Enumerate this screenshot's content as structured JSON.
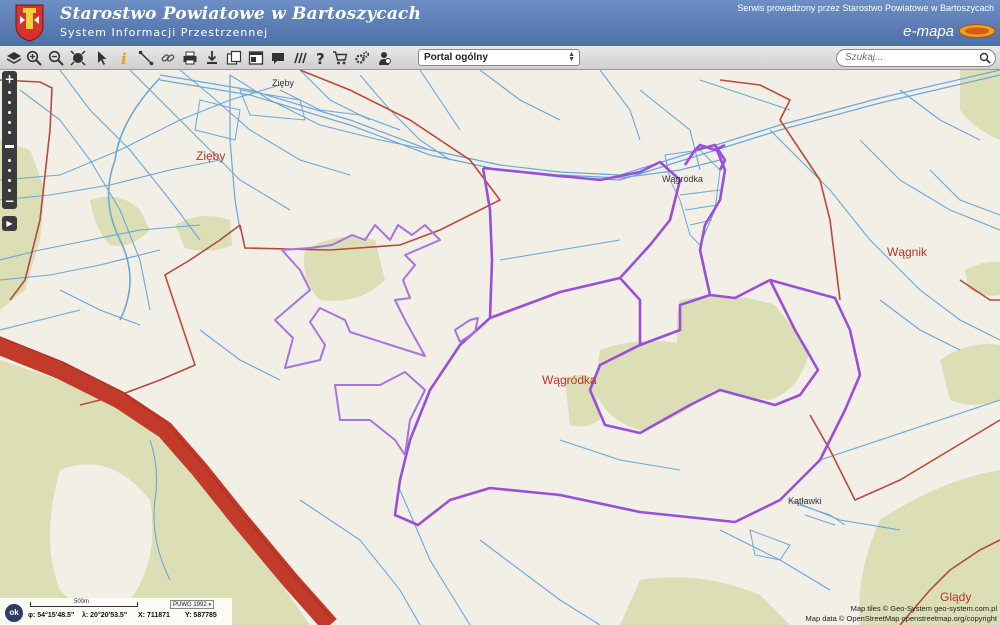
{
  "header": {
    "title": "Starostwo Powiatowe w Bartoszycach",
    "subtitle": "System Informacji Przestrzennej",
    "service_note": "Serwis prowadzony przez Starostwo Powiatowe w Bartoszycach",
    "brand": "e-mapa",
    "crest_icon": "county-crest-icon",
    "brand_logo": "emapa-logo-icon"
  },
  "toolbar": {
    "tools": [
      {
        "name": "layers-icon"
      },
      {
        "name": "zoom-in-icon"
      },
      {
        "name": "zoom-out-icon"
      },
      {
        "name": "full-extent-icon"
      },
      {
        "name": "pointer-icon"
      },
      {
        "name": "info-icon"
      },
      {
        "name": "measure-distance-icon"
      },
      {
        "name": "link-icon"
      },
      {
        "name": "print-icon"
      },
      {
        "name": "download-icon"
      },
      {
        "name": "copy-icon"
      },
      {
        "name": "window-icon"
      },
      {
        "name": "comment-icon"
      },
      {
        "name": "hatch-icon"
      },
      {
        "name": "help-icon"
      },
      {
        "name": "cart-icon"
      },
      {
        "name": "settings-icon"
      },
      {
        "name": "user-location-icon"
      }
    ],
    "portal_select": {
      "selected": "Portal ogólny"
    },
    "search": {
      "placeholder": "Szukaj..."
    }
  },
  "map": {
    "places": [
      {
        "id": "zieby-red",
        "label": "Zięby"
      },
      {
        "id": "zieby-small",
        "label": "Zięby"
      },
      {
        "id": "wagrodka-small",
        "label": "Wągródka"
      },
      {
        "id": "wagrodka-red",
        "label": "Wągródka"
      },
      {
        "id": "wagnik",
        "label": "Wągnik"
      },
      {
        "id": "katlawki",
        "label": "Kątławki"
      },
      {
        "id": "gledy",
        "label": "Glądy"
      }
    ],
    "colors": {
      "background": "#f2efe6",
      "forest": "#dcdfb6",
      "road": "#c13a2a",
      "admin_boundary": "#b84a3c",
      "parcel_lines": "#6aa8d8",
      "selection": "#9b4fd8"
    }
  },
  "footer": {
    "ok_label": "ok",
    "scale_label": "500m",
    "crs": "PUWG 1992",
    "lat": "φ: 54°15'48.5\"",
    "lon": "λ: 20°20'53.5\"",
    "x": "X: 711871",
    "y": "Y: 587785",
    "attribution_tiles": "Map tiles © Geo-System geo-system.com.pl",
    "attribution_data": "Map data © OpenStreetMap openstreetmap.org/copyright"
  }
}
